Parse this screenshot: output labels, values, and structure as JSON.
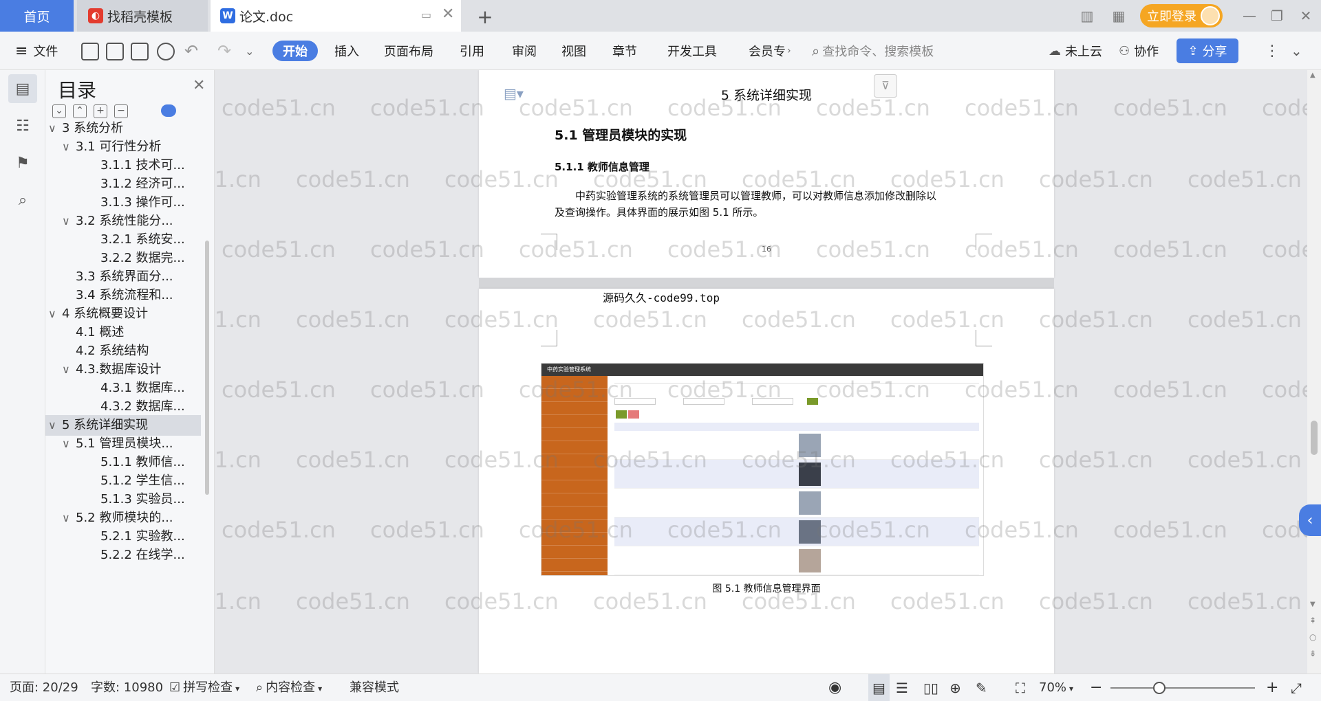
{
  "tabs": {
    "home": "首页",
    "template": "找稻壳模板",
    "doc": "论文.doc"
  },
  "titlebar": {
    "login": "立即登录"
  },
  "menu": {
    "file": "文件",
    "start": "开始",
    "items": [
      "插入",
      "页面布局",
      "引用",
      "审阅",
      "视图",
      "章节",
      "开发工具",
      "会员专"
    ],
    "search_placeholder": "查找命令、搜索模板",
    "cloud": "未上云",
    "collab": "协作",
    "share": "分享"
  },
  "toc": {
    "title": "目录",
    "items": [
      {
        "label": "3 系统分析",
        "level": 1,
        "caret": "∨"
      },
      {
        "label": "3.1 可行性分析",
        "level": 2,
        "caret": "∨"
      },
      {
        "label": "3.1.1 技术可...",
        "level": 3,
        "caret": ""
      },
      {
        "label": "3.1.2 经济可...",
        "level": 3,
        "caret": ""
      },
      {
        "label": "3.1.3 操作可...",
        "level": 3,
        "caret": ""
      },
      {
        "label": "3.2 系统性能分...",
        "level": 2,
        "caret": "∨"
      },
      {
        "label": "3.2.1  系统安...",
        "level": 3,
        "caret": ""
      },
      {
        "label": "3.2.2  数据完...",
        "level": 3,
        "caret": ""
      },
      {
        "label": "3.3 系统界面分...",
        "level": 2,
        "caret": ""
      },
      {
        "label": "3.4 系统流程和...",
        "level": 2,
        "caret": ""
      },
      {
        "label": "4 系统概要设计",
        "level": 1,
        "caret": "∨"
      },
      {
        "label": "4.1 概述",
        "level": 2,
        "caret": ""
      },
      {
        "label": "4.2 系统结构",
        "level": 2,
        "caret": ""
      },
      {
        "label": "4.3.数据库设计",
        "level": 2,
        "caret": "∨"
      },
      {
        "label": "4.3.1 数据库...",
        "level": 3,
        "caret": ""
      },
      {
        "label": "4.3.2 数据库...",
        "level": 3,
        "caret": ""
      },
      {
        "label": "5 系统详细实现",
        "level": 1,
        "caret": "∨",
        "selected": true
      },
      {
        "label": "5.1  管理员模块...",
        "level": 2,
        "caret": "∨"
      },
      {
        "label": "5.1.1  教师信...",
        "level": 3,
        "caret": ""
      },
      {
        "label": "5.1.2  学生信...",
        "level": 3,
        "caret": ""
      },
      {
        "label": "5.1.3  实验员...",
        "level": 3,
        "caret": ""
      },
      {
        "label": "5.2  教师模块的...",
        "level": 2,
        "caret": "∨"
      },
      {
        "label": "5.2.1  实验教...",
        "level": 3,
        "caret": ""
      },
      {
        "label": "5.2.2  在线学...",
        "level": 3,
        "caret": ""
      }
    ]
  },
  "document": {
    "header_text": "5 系统详细实现",
    "h2": "5.1  管理员模块的实现",
    "h3": "5.1.1  教师信息管理",
    "paragraph_line1": "中药实验管理系统的系统管理员可以管理教师，可以对教师信息添加修改删除以",
    "paragraph_line2": "及查询操作。具体界面的展示如图 5.1 所示。",
    "page_number": "16",
    "page2_note": "源码久久-code99.top",
    "figure_caption": "图 5.1  教师信息管理界面",
    "watermark": "code51.cn"
  },
  "embedded_screenshot": {
    "app_title": "中药实验管理系统"
  },
  "status": {
    "page": "页面: 20/29",
    "words": "字数: 10980",
    "spell": "拼写检查",
    "content": "内容检查",
    "compat": "兼容模式",
    "zoom": "70%"
  },
  "colors": {
    "accent": "#4a7de2",
    "login": "#f5a623",
    "sidebar_orange": "#c8661d"
  }
}
